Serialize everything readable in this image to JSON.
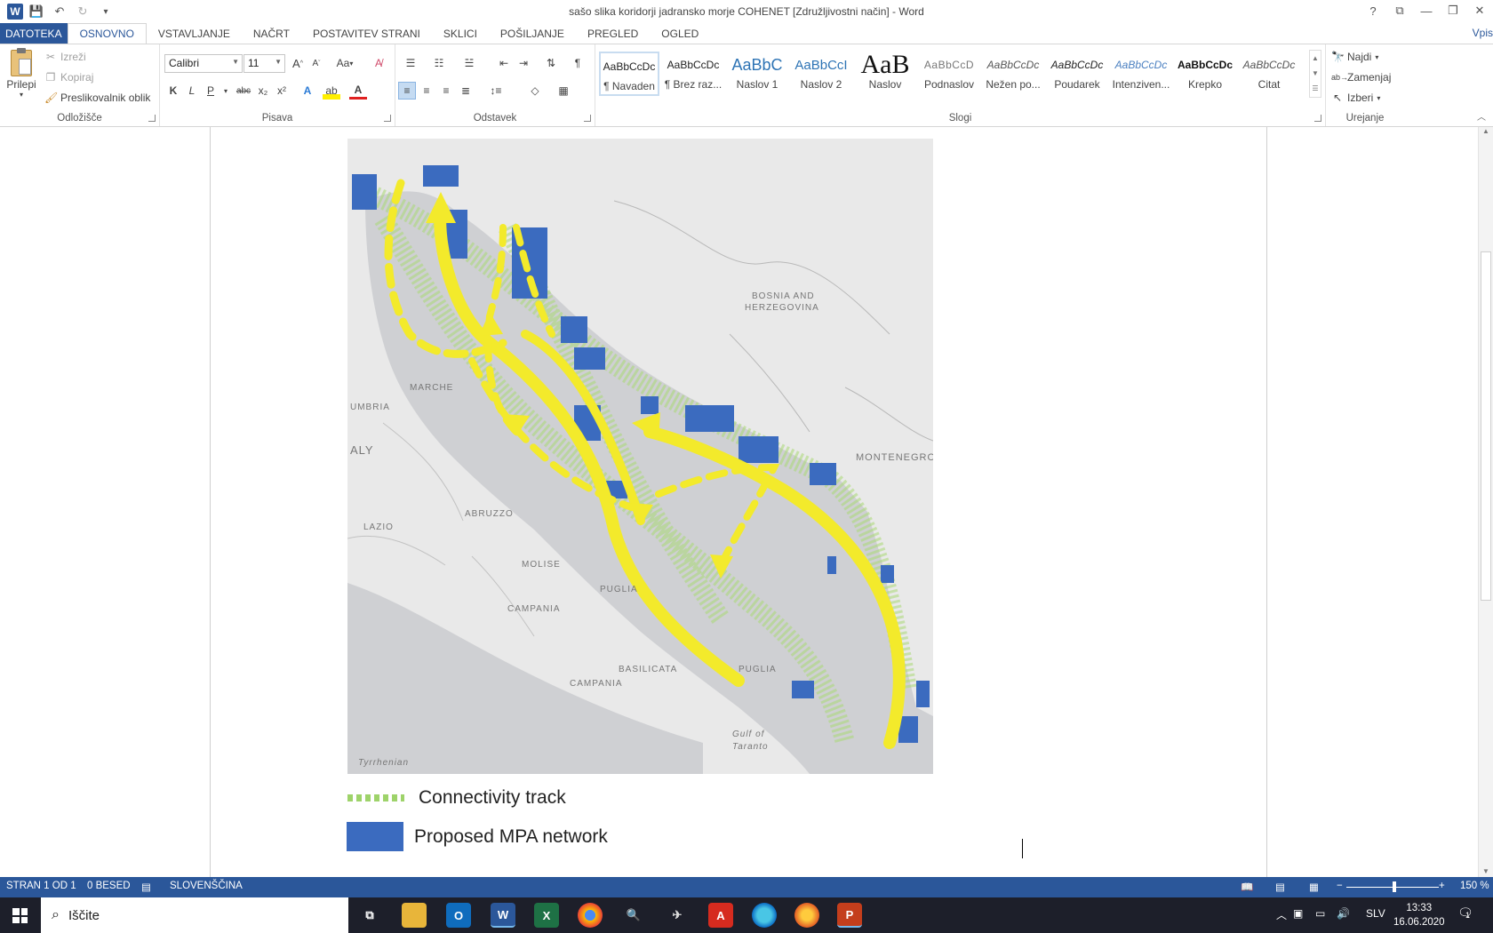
{
  "window": {
    "title": "sašo slika koridorji jadransko morje COHENET [Združljivostni način] - Word",
    "help": "?",
    "restore_ribbon": "⧉",
    "minimize": "—",
    "maximize": "❐",
    "close": "✕"
  },
  "qat": {
    "save": "💾",
    "undo": "↶",
    "redo": "↻",
    "customize": "▾"
  },
  "tabs": [
    "DATOTEKA",
    "OSNOVNO",
    "VSTAVLJANJE",
    "NAČRT",
    "POSTAVITEV STRANI",
    "SKLICI",
    "POŠILJANJE",
    "PREGLED",
    "OGLED"
  ],
  "signin": "Vpis",
  "clipboard": {
    "paste": "Prilepi",
    "cut": "Izreži",
    "copy": "Kopiraj",
    "format_painter": "Preslikovalnik oblik",
    "label": "Odložišče"
  },
  "font": {
    "name": "Calibri",
    "size": "11",
    "bold": "K",
    "italic": "L",
    "underline": "P",
    "strike": "abc",
    "subscript": "x₂",
    "superscript": "x²",
    "case": "Aa",
    "grow": "A",
    "shrink": "A",
    "label": "Pisava"
  },
  "paragraph": {
    "label": "Odstavek",
    "pilcrow": "¶"
  },
  "styles": {
    "label": "Slogi",
    "items": [
      {
        "sample": "AaBbCcDc",
        "name": "¶ Navaden"
      },
      {
        "sample": "AaBbCcDc",
        "name": "¶ Brez raz..."
      },
      {
        "sample": "AaBbC",
        "name": "Naslov 1"
      },
      {
        "sample": "AaBbCcI",
        "name": "Naslov 2"
      },
      {
        "sample": "AaB",
        "name": "Naslov"
      },
      {
        "sample": "AaBbCcD",
        "name": "Podnaslov"
      },
      {
        "sample": "AaBbCcDc",
        "name": "Nežen po..."
      },
      {
        "sample": "AaBbCcDc",
        "name": "Poudarek"
      },
      {
        "sample": "AaBbCcDc",
        "name": "Intenziven..."
      },
      {
        "sample": "AaBbCcDc",
        "name": "Krepko"
      },
      {
        "sample": "AaBbCcDc",
        "name": "Citat"
      }
    ]
  },
  "editing": {
    "find": "Najdi",
    "replace": "Zamenjaj",
    "select": "Izberi",
    "label": "Urejanje"
  },
  "map": {
    "labels": {
      "bosnia1": "BOSNIA AND",
      "bosnia2": "HERZEGOVINA",
      "marche": "MARCHE",
      "umbria": "UMBRIA",
      "italy": "ALY",
      "montenegro": "MONTENEGRO",
      "lazio": "LAZIO",
      "abruzzo": "ABRUZZO",
      "molise": "MOLISE",
      "puglia": "PUGLIA",
      "campania": "CAMPANIA",
      "campania2": "CAMPANIA",
      "basilicata": "BASILICATA",
      "puglia2": "PUGLIA",
      "gulf1": "Gulf of",
      "gulf2": "Taranto",
      "tyrrhenian": "Tyrrhenian"
    },
    "colors": {
      "sea": "#cfd0d3",
      "land": "#e9e9e9",
      "mpa": "#3b6bbf",
      "track": "#9ed36a",
      "arrow": "#f3ea2b"
    }
  },
  "legend": {
    "track": "Connectivity track",
    "mpa": "Proposed MPA network"
  },
  "status": {
    "page": "STRAN 1 OD 1",
    "words": "0 BESED",
    "language": "SLOVENŠČINA",
    "zoom": "150 %"
  },
  "taskbar": {
    "search_placeholder": "Iščite",
    "time": "13:33",
    "date": "16.06.2020",
    "lang": "SLV",
    "notifications": "1"
  }
}
